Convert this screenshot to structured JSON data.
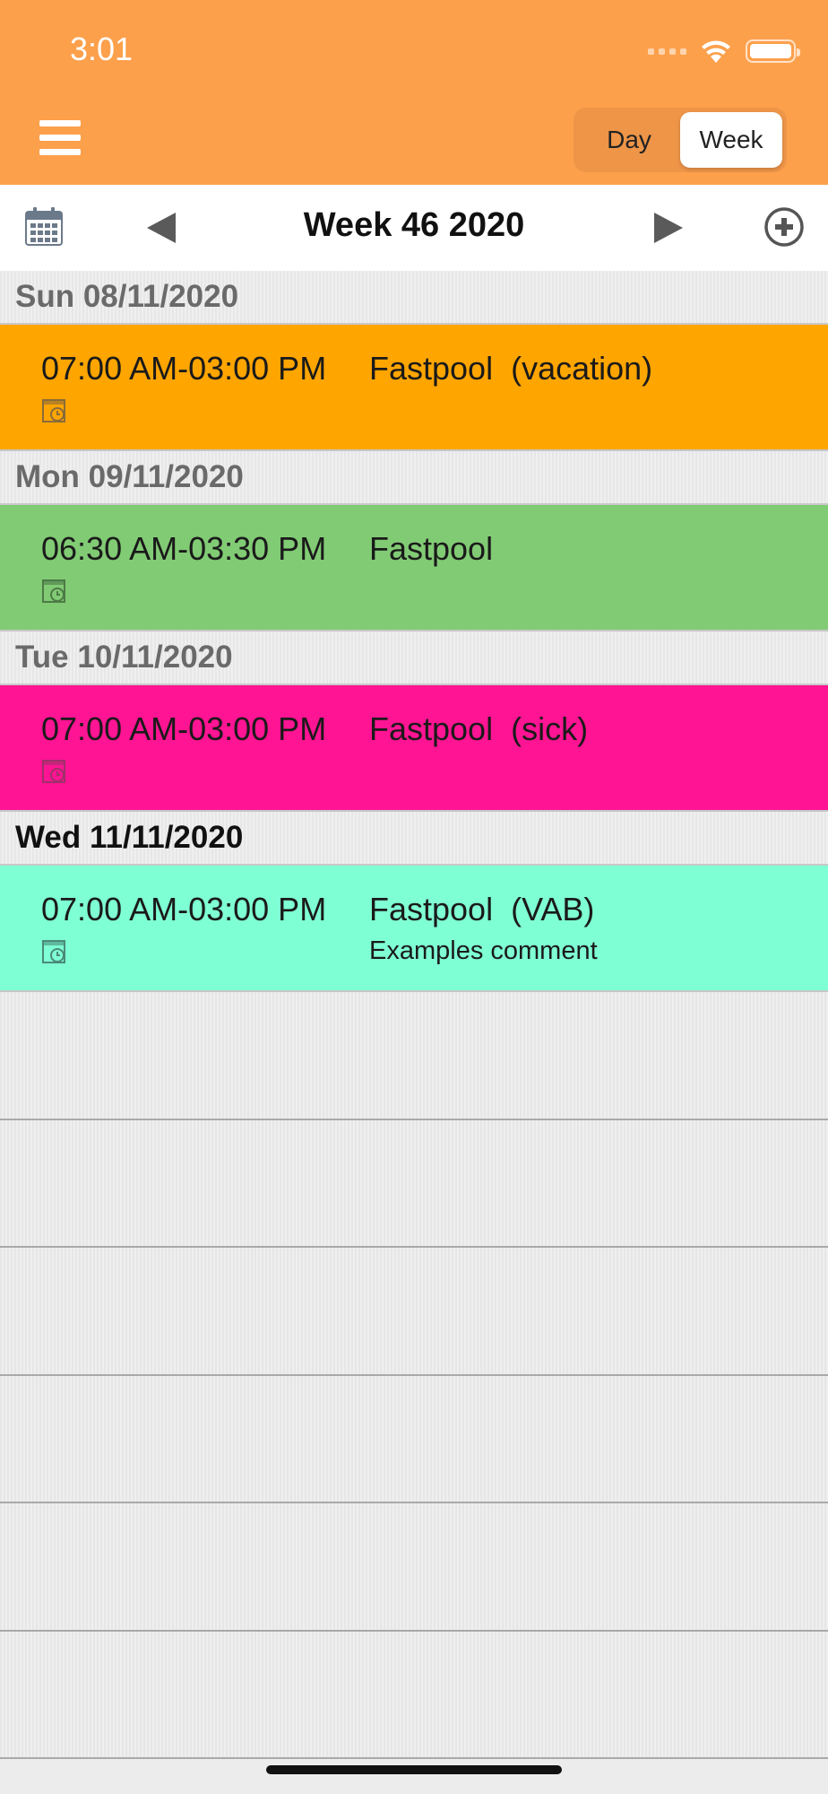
{
  "status_bar": {
    "time": "3:01"
  },
  "nav": {
    "segments": [
      "Day",
      "Week"
    ],
    "selected_segment": "Week"
  },
  "week_header": {
    "title": "Week 46 2020"
  },
  "days": [
    {
      "label": "Sun 08/11/2020",
      "entry": {
        "time": "07:00 AM-03:00 PM",
        "place": "Fastpool  (vacation)",
        "comment": "",
        "color": "#ffa500"
      }
    },
    {
      "label": "Mon 09/11/2020",
      "entry": {
        "time": "06:30 AM-03:30 PM",
        "place": "Fastpool",
        "comment": "",
        "color": "#81cb74"
      }
    },
    {
      "label": "Tue 10/11/2020",
      "entry": {
        "time": "07:00 AM-03:00 PM",
        "place": "Fastpool  (sick)",
        "comment": "",
        "color": "#ff1493"
      }
    },
    {
      "label": "Wed 11/11/2020",
      "entry": {
        "time": "07:00 AM-03:00 PM",
        "place": "Fastpool  (VAB)",
        "comment": "Examples comment",
        "color": "#7fffd4"
      }
    }
  ],
  "colors": {
    "topbar": "#fda04c",
    "segmented_bg": "#ee9548"
  }
}
